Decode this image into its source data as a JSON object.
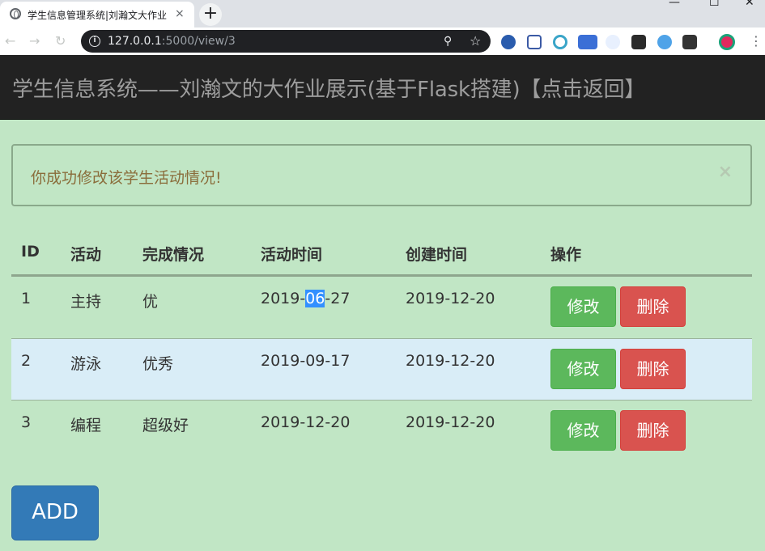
{
  "browser": {
    "tab_title": "学生信息管理系统|刘瀚文大作业",
    "tab_close": "×",
    "new_tab": "+",
    "url_host": "127.0.0.1",
    "url_path": ":5000/view/3",
    "window_controls": [
      "—",
      "☐",
      "✕"
    ]
  },
  "navbar": {
    "brand": "学生信息系统——刘瀚文的大作业展示(基于Flask搭建)【点击返回】"
  },
  "alert": {
    "message": "你成功修改该学生活动情况!",
    "close": "×"
  },
  "table": {
    "headers": [
      "ID",
      "活动",
      "完成情况",
      "活动时间",
      "创建时间",
      "操作"
    ],
    "rows": [
      {
        "id": "1",
        "activity": "主持",
        "status": "优",
        "act_time_pre": "2019-",
        "act_time_sel": "06",
        "act_time_post": "-27",
        "created": "2019-12-20",
        "edit": "修改",
        "delete": "删除"
      },
      {
        "id": "2",
        "activity": "游泳",
        "status": "优秀",
        "act_time": "2019-09-17",
        "created": "2019-12-20",
        "edit": "修改",
        "delete": "删除"
      },
      {
        "id": "3",
        "activity": "编程",
        "status": "超级好",
        "act_time": "2019-12-20",
        "created": "2019-12-20",
        "edit": "修改",
        "delete": "删除"
      }
    ]
  },
  "add_button": "ADD",
  "colors": {
    "page_bg": "#c1e6c5",
    "navbar_bg": "#222222",
    "edit_button": "#5cb85c",
    "delete_button": "#d9534f",
    "add_button": "#337ab7",
    "highlight_row": "#d9edf7"
  }
}
